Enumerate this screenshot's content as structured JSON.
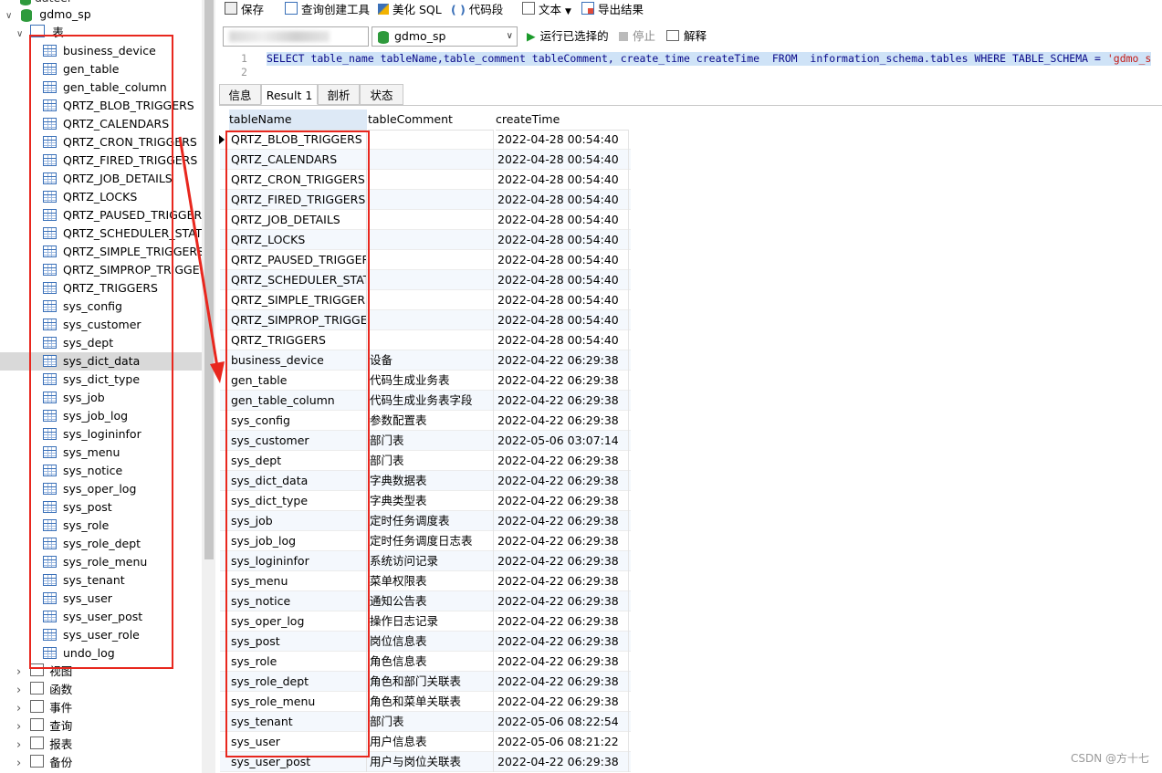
{
  "sidebar": {
    "top_cut_label": "dateel",
    "database_name": "gdmo_sp",
    "tables_folder_label": "表",
    "tables": [
      "business_device",
      "gen_table",
      "gen_table_column",
      "QRTZ_BLOB_TRIGGERS",
      "QRTZ_CALENDARS",
      "QRTZ_CRON_TRIGGERS",
      "QRTZ_FIRED_TRIGGERS",
      "QRTZ_JOB_DETAILS",
      "QRTZ_LOCKS",
      "QRTZ_PAUSED_TRIGGER_GRPS",
      "QRTZ_SCHEDULER_STATE",
      "QRTZ_SIMPLE_TRIGGERS",
      "QRTZ_SIMPROP_TRIGGERS",
      "QRTZ_TRIGGERS",
      "sys_config",
      "sys_customer",
      "sys_dept",
      "sys_dict_data",
      "sys_dict_type",
      "sys_job",
      "sys_job_log",
      "sys_logininfor",
      "sys_menu",
      "sys_notice",
      "sys_oper_log",
      "sys_post",
      "sys_role",
      "sys_role_dept",
      "sys_role_menu",
      "sys_tenant",
      "sys_user",
      "sys_user_post",
      "sys_user_role",
      "undo_log"
    ],
    "selected_table": "sys_dict_data",
    "folders": [
      {
        "label": "视图",
        "icon": "view-icon"
      },
      {
        "label": "函数",
        "icon": "function-icon"
      },
      {
        "label": "事件",
        "icon": "event-icon"
      },
      {
        "label": "查询",
        "icon": "query-icon"
      },
      {
        "label": "报表",
        "icon": "report-icon"
      },
      {
        "label": "备份",
        "icon": "backup-icon"
      }
    ]
  },
  "toolbar": {
    "save": "保存",
    "query_builder": "查询创建工具",
    "beautify_sql": "美化 SQL",
    "code_snippet": "代码段",
    "text": "文本",
    "export_results": "导出结果",
    "database_selected": "gdmo_sp",
    "run_selected": "运行已选择的",
    "stop": "停止",
    "explain": "解释"
  },
  "editor": {
    "line_numbers": [
      "1",
      "2"
    ],
    "sql_prefix": "SELECT table_name tableName,table_comment tableComment, create_time createTime  FROM  information_schema.",
    "sql_tables": "tables",
    "sql_where": " WHERE TABLE_SCHEMA = ",
    "sql_string": "'gdmo_s"
  },
  "tabs": [
    "信息",
    "Result 1",
    "剖析",
    "状态"
  ],
  "active_tab": "Result 1",
  "result": {
    "columns": [
      "tableName",
      "tableComment",
      "createTime"
    ],
    "rows": [
      [
        "QRTZ_BLOB_TRIGGERS",
        "",
        "2022-04-28 00:54:40"
      ],
      [
        "QRTZ_CALENDARS",
        "",
        "2022-04-28 00:54:40"
      ],
      [
        "QRTZ_CRON_TRIGGERS",
        "",
        "2022-04-28 00:54:40"
      ],
      [
        "QRTZ_FIRED_TRIGGERS",
        "",
        "2022-04-28 00:54:40"
      ],
      [
        "QRTZ_JOB_DETAILS",
        "",
        "2022-04-28 00:54:40"
      ],
      [
        "QRTZ_LOCKS",
        "",
        "2022-04-28 00:54:40"
      ],
      [
        "QRTZ_PAUSED_TRIGGER_GRPS",
        "",
        "2022-04-28 00:54:40"
      ],
      [
        "QRTZ_SCHEDULER_STATE",
        "",
        "2022-04-28 00:54:40"
      ],
      [
        "QRTZ_SIMPLE_TRIGGERS",
        "",
        "2022-04-28 00:54:40"
      ],
      [
        "QRTZ_SIMPROP_TRIGGERS",
        "",
        "2022-04-28 00:54:40"
      ],
      [
        "QRTZ_TRIGGERS",
        "",
        "2022-04-28 00:54:40"
      ],
      [
        "business_device",
        "设备",
        "2022-04-22 06:29:38"
      ],
      [
        "gen_table",
        "代码生成业务表",
        "2022-04-22 06:29:38"
      ],
      [
        "gen_table_column",
        "代码生成业务表字段",
        "2022-04-22 06:29:38"
      ],
      [
        "sys_config",
        "参数配置表",
        "2022-04-22 06:29:38"
      ],
      [
        "sys_customer",
        "部门表",
        "2022-05-06 03:07:14"
      ],
      [
        "sys_dept",
        "部门表",
        "2022-04-22 06:29:38"
      ],
      [
        "sys_dict_data",
        "字典数据表",
        "2022-04-22 06:29:38"
      ],
      [
        "sys_dict_type",
        "字典类型表",
        "2022-04-22 06:29:38"
      ],
      [
        "sys_job",
        "定时任务调度表",
        "2022-04-22 06:29:38"
      ],
      [
        "sys_job_log",
        "定时任务调度日志表",
        "2022-04-22 06:29:38"
      ],
      [
        "sys_logininfor",
        "系统访问记录",
        "2022-04-22 06:29:38"
      ],
      [
        "sys_menu",
        "菜单权限表",
        "2022-04-22 06:29:38"
      ],
      [
        "sys_notice",
        "通知公告表",
        "2022-04-22 06:29:38"
      ],
      [
        "sys_oper_log",
        "操作日志记录",
        "2022-04-22 06:29:38"
      ],
      [
        "sys_post",
        "岗位信息表",
        "2022-04-22 06:29:38"
      ],
      [
        "sys_role",
        "角色信息表",
        "2022-04-22 06:29:38"
      ],
      [
        "sys_role_dept",
        "角色和部门关联表",
        "2022-04-22 06:29:38"
      ],
      [
        "sys_role_menu",
        "角色和菜单关联表",
        "2022-04-22 06:29:38"
      ],
      [
        "sys_tenant",
        "部门表",
        "2022-05-06 08:22:54"
      ],
      [
        "sys_user",
        "用户信息表",
        "2022-05-06 08:21:22"
      ],
      [
        "sys_user_post",
        "用户与岗位关联表",
        "2022-04-22 06:29:38"
      ]
    ]
  },
  "watermark": "CSDN @方十七",
  "colors": {
    "annotation_red": "#e8271e",
    "selection_bg": "#cfe3f7",
    "db_green": "#2e9a3c"
  }
}
